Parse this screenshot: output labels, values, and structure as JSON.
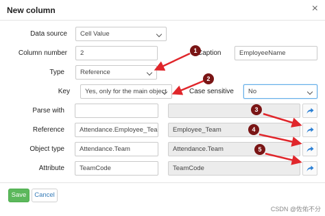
{
  "dialog": {
    "title": "New column",
    "close_glyph": "×"
  },
  "form": {
    "data_source": {
      "label": "Data source",
      "value": "Cell Value"
    },
    "column_number": {
      "label": "Column number",
      "value": "2"
    },
    "caption": {
      "label": "Caption",
      "value": "EmployeeName"
    },
    "type": {
      "label": "Type",
      "value": "Reference"
    },
    "key": {
      "label": "Key",
      "value": "Yes, only for the main object"
    },
    "case_sensitive": {
      "label": "Case sensitive",
      "value": "No"
    },
    "parse_with": {
      "label": "Parse with",
      "value": "",
      "resolved": ""
    },
    "reference": {
      "label": "Reference",
      "value": "Attendance.Employee_Team",
      "resolved": "Employee_Team"
    },
    "object_type": {
      "label": "Object type",
      "value": "Attendance.Team",
      "resolved": "Attendance.Team"
    },
    "attribute": {
      "label": "Attribute",
      "value": "TeamCode",
      "resolved": "TeamCode"
    }
  },
  "buttons": {
    "save": "Save",
    "cancel": "Cancel"
  },
  "annotations": {
    "badges": [
      "1",
      "2",
      "3",
      "4",
      "5"
    ],
    "color": "#7a1515",
    "arrow_color": "#e0262b"
  },
  "icons": {
    "pick": "share-arrow-icon",
    "pick_color": "#2a7fd4"
  },
  "watermark": "CSDN @佐佑不分"
}
